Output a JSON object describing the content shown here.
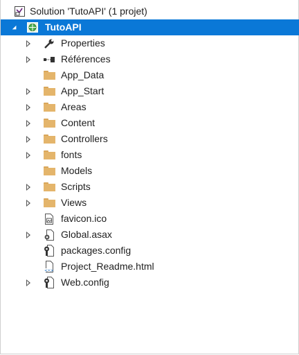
{
  "solution": {
    "label": "Solution 'TutoAPI' (1 projet)",
    "icon": "solution-icon"
  },
  "project": {
    "label": "TutoAPI",
    "icon": "web-project-icon",
    "expanded": true,
    "selected": true,
    "selection_color": "#0a78d7"
  },
  "items": [
    {
      "label": "Properties",
      "icon": "wrench-icon",
      "expandable": true
    },
    {
      "label": "Références",
      "icon": "references-icon",
      "expandable": true
    },
    {
      "label": "App_Data",
      "icon": "folder-icon",
      "expandable": false
    },
    {
      "label": "App_Start",
      "icon": "folder-icon",
      "expandable": true
    },
    {
      "label": "Areas",
      "icon": "folder-icon",
      "expandable": true
    },
    {
      "label": "Content",
      "icon": "folder-icon",
      "expandable": true
    },
    {
      "label": "Controllers",
      "icon": "folder-icon",
      "expandable": true
    },
    {
      "label": "fonts",
      "icon": "folder-icon",
      "expandable": true
    },
    {
      "label": "Models",
      "icon": "folder-icon",
      "expandable": false
    },
    {
      "label": "Scripts",
      "icon": "folder-icon",
      "expandable": true
    },
    {
      "label": "Views",
      "icon": "folder-icon",
      "expandable": true
    },
    {
      "label": "favicon.ico",
      "icon": "image-file-icon",
      "expandable": false
    },
    {
      "label": "Global.asax",
      "icon": "asax-file-icon",
      "expandable": true
    },
    {
      "label": "packages.config",
      "icon": "config-file-icon",
      "expandable": false
    },
    {
      "label": "Project_Readme.html",
      "icon": "html-file-icon",
      "expandable": false
    },
    {
      "label": "Web.config",
      "icon": "config-file-icon",
      "expandable": true
    }
  ]
}
